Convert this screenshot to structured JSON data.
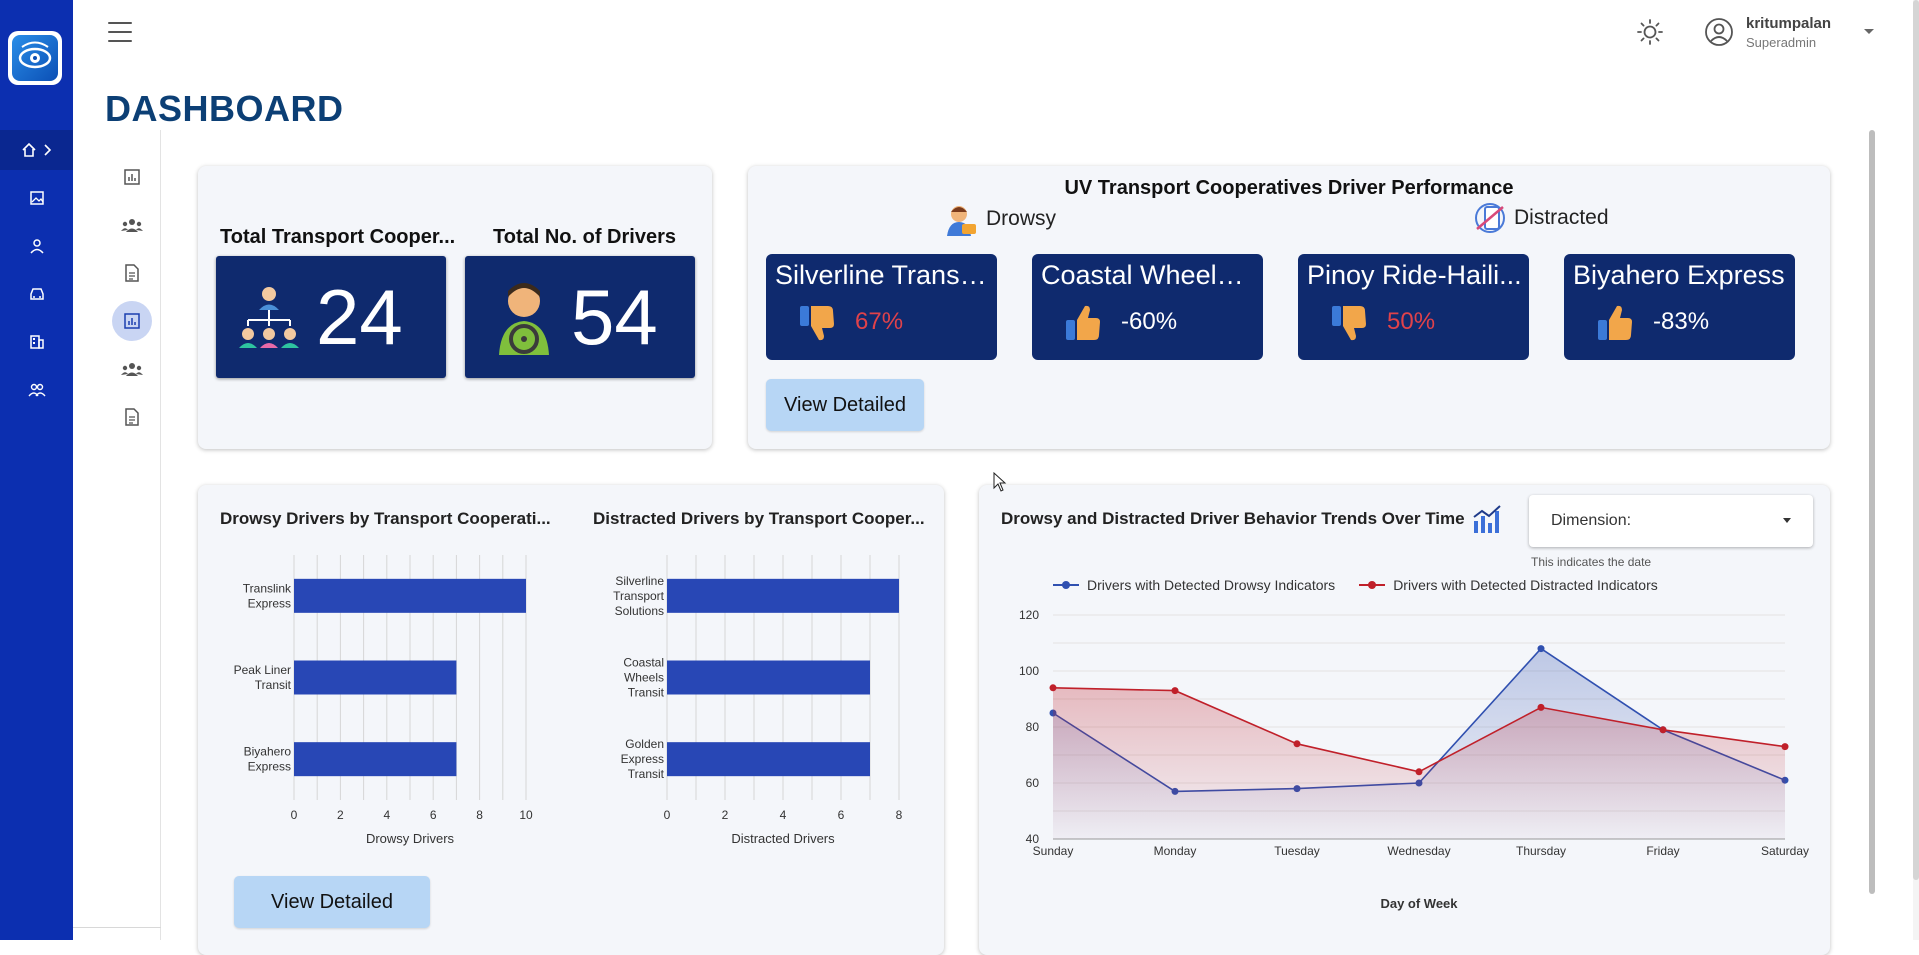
{
  "header": {
    "title": "DASHBOARD",
    "user_name": "kritumpalan",
    "user_role": "Superadmin"
  },
  "nav": {
    "items": [
      "home-icon",
      "gallery-icon",
      "person-icon",
      "car-icon",
      "building-icon",
      "group-icon"
    ],
    "sub_items": [
      "report-icon",
      "group-icon",
      "document-icon",
      "report-icon",
      "group-icon",
      "document-icon"
    ]
  },
  "kpis": [
    {
      "label": "Total Transport Cooper...",
      "value": "24",
      "icon": "org-chart-icon"
    },
    {
      "label": "Total No. of Drivers",
      "value": "54",
      "icon": "driver-icon"
    }
  ],
  "performance": {
    "title": "UV Transport Cooperatives Driver Performance",
    "legend": [
      {
        "label": "Drowsy",
        "icon": "drowsy-driver-icon"
      },
      {
        "label": "Distracted",
        "icon": "phone-distracted-icon"
      }
    ],
    "cooperatives": [
      {
        "name": "Silverline Transp...",
        "percent": "67%",
        "trend": "thumbs-down",
        "color": "#e0424a"
      },
      {
        "name": "Coastal Wheels ...",
        "percent": "-60%",
        "trend": "thumbs-up",
        "color": "#ffffff"
      },
      {
        "name": "Pinoy Ride-Haili...",
        "percent": "50%",
        "trend": "thumbs-down",
        "color": "#e0424a"
      },
      {
        "name": "Biyahero Express",
        "percent": "-83%",
        "trend": "thumbs-up",
        "color": "#ffffff"
      }
    ],
    "view_button": "View Detailed"
  },
  "bar_charts": {
    "view_button": "View Detailed"
  },
  "trends": {
    "dimension_label": "Dimension:",
    "dimension_help": "This indicates the date"
  },
  "chart_data": [
    {
      "type": "bar",
      "orientation": "horizontal",
      "title": "Drowsy Drivers by Transport Cooperati...",
      "categories": [
        "Translink Express",
        "Peak Liner Transit",
        "Biyahero Express"
      ],
      "values": [
        10,
        7,
        7
      ],
      "xlabel": "Drowsy Drivers",
      "xlim": [
        0,
        10
      ],
      "xticks": [
        0,
        2,
        4,
        6,
        8,
        10
      ],
      "color": "#2847b5"
    },
    {
      "type": "bar",
      "orientation": "horizontal",
      "title": "Distracted Drivers by Transport Cooper...",
      "categories": [
        "Silverline Transport Solutions",
        "Coastal Wheels Transit",
        "Golden Express Transit"
      ],
      "values": [
        8,
        7,
        7
      ],
      "xlabel": "Distracted Drivers",
      "xlim": [
        0,
        8
      ],
      "xticks": [
        0,
        2,
        4,
        6,
        8
      ],
      "color": "#2847b5"
    },
    {
      "type": "area",
      "title": "Drowsy and Distracted Driver Behavior Trends Over Time",
      "categories": [
        "Sunday",
        "Monday",
        "Tuesday",
        "Wednesday",
        "Thursday",
        "Friday",
        "Saturday"
      ],
      "series": [
        {
          "name": "Drivers with Detected Drowsy Indicators",
          "values": [
            85,
            57,
            58,
            60,
            108,
            79,
            61
          ],
          "color": "#3050b0"
        },
        {
          "name": "Drivers with Detected Distracted Indicators",
          "values": [
            94,
            93,
            74,
            64,
            87,
            79,
            73
          ],
          "color": "#c0202a"
        }
      ],
      "xlabel": "Day of Week",
      "ylim": [
        40,
        120
      ],
      "yticks": [
        40,
        60,
        80,
        100,
        120
      ],
      "grid": true,
      "legend": "top"
    }
  ]
}
